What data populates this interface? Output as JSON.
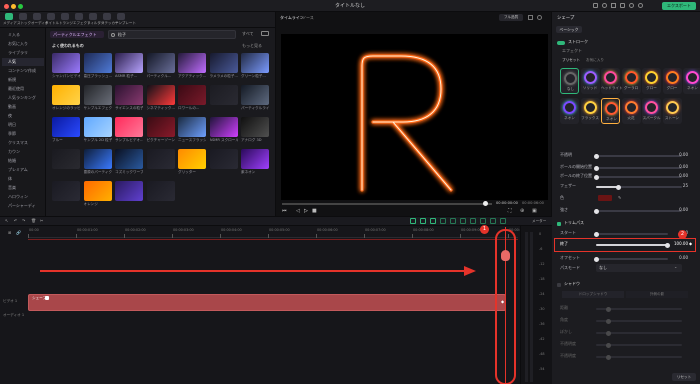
{
  "app": {
    "window_title": "タイトルなし"
  },
  "window_controls": [
    "#ff5f57",
    "#febc2e",
    "#28c840"
  ],
  "toolbar": {
    "items": [
      "メディア",
      "ストック",
      "オーディオ",
      "タイトル",
      "トランジ",
      "エフェクト",
      "フィルター",
      "ステッカー",
      "テンプレート"
    ]
  },
  "library": {
    "search_tab_label": "パーティクルエフェクト",
    "search_value": "粒子",
    "filter_label": "すべて",
    "sort_label": "もっと見る",
    "section_title": "よく使われるもの",
    "sort_label_2": "もっと見る",
    "items": [
      "シャンパンビデオ...",
      "高圧ブラッシュ...",
      "ASMR 粒子...",
      "パーティクル...",
      "アクアティック...",
      "ラメラメの粒子...",
      "グリーン粒子...",
      "オレンジのラッピング",
      "サンプルエフェクト...",
      "サイエンスの粒子...",
      "シネマティック...",
      "ロワールの...",
      "",
      "パーティクルライト",
      "ブルー",
      "サンプル 2D 粒子",
      "サンプルビデオ...",
      "ピクチャーゾーン",
      "ニュースフラッシュ",
      "ASMR スクロール",
      "アナログ 3D",
      "",
      "雪原のパーティクル",
      "コズミックワープ",
      "",
      "グリッター",
      "",
      "紫ネオン",
      "",
      "オレンジ",
      "",
      ""
    ]
  },
  "leftnav": {
    "items": [
      "ミ入る",
      "お気に入り",
      "ライブラリ",
      "人気",
      "コンテンツ作成",
      "新規",
      "最近使用",
      "人気ランキング",
      "動画",
      "夜",
      "明日",
      "季節",
      "クリスマス",
      "カウン",
      "結婚",
      "プレミアム",
      "体",
      "音楽",
      "ハロウィン",
      "パーシャーディ"
    ]
  },
  "preview": {
    "tab_player": "タイムライン",
    "tab_label": "ソース",
    "quality": "フル品質",
    "time_current": "00:00:00:00",
    "time_total": "00:00:06:00",
    "letter": "R"
  },
  "inspector": {
    "title": "シェープ",
    "tab_basic": "ベーシック",
    "stroke_section": "ストローク",
    "section_effect": "エフェクト",
    "preset_tab": "プリセット",
    "custom_tab": "お気に入り",
    "presets_row1": [
      "なし",
      "ソリッド",
      "ヘッドライト",
      "グーラロ",
      "グロー",
      "グロー",
      "ネオン"
    ],
    "presets_row2": [
      "ネオン",
      "フラックス",
      "ネオン",
      "火花",
      "スパークル",
      "ストーン"
    ],
    "sliders": [
      {
        "label": "不透明",
        "value": "0.00",
        "fraction": 0.0
      },
      {
        "label": "ボールの開始位置",
        "value": "0.00",
        "fraction": 0.0
      },
      {
        "label": "ボールの終了位置",
        "value": "0.00",
        "fraction": 0.0
      },
      {
        "label": "フェザー",
        "value": "25",
        "fraction": 0.25
      },
      {
        "label": "色",
        "value": "",
        "fraction": 0
      },
      {
        "label": "強さ",
        "value": "0.00",
        "fraction": 0.0
      }
    ],
    "trim_section": "トリムパス",
    "start_label": "スタート",
    "start_value": "0.00",
    "end_label": "終了",
    "end_value": "100.00",
    "offset_label": "オフセット",
    "offset_value": "0.00",
    "mode_label": "パスモード",
    "mode_value": "なし",
    "shadow_section": "シャドウ",
    "shadow_tab1": "ドロップシャドウ",
    "shadow_tab2": "外側の影",
    "shadow_rows": [
      "距離",
      "角度",
      "ぼかし",
      "不透明度",
      "不透明度"
    ],
    "reset_label": "リセット",
    "done_label": "エクスポート",
    "badge1": "1",
    "badge2": "2"
  },
  "timeline": {
    "ruler_ticks": [
      "00:00",
      "00:00:01:00",
      "00:00:02:00",
      "00:00:03:00",
      "00:00:04:00",
      "00:00:05:00",
      "00:00:06:00",
      "00:00:07:00",
      "00:00:08:00",
      "00:00:09:00",
      "00:00:10:00"
    ],
    "clip_label": "シェープ",
    "track_v": "ビデオ 1",
    "track_a": "オーディオ 1",
    "meter_labels": [
      "0",
      "-6",
      "-12",
      "-18",
      "-24",
      "-30",
      "-36",
      "-42",
      "-48",
      "-54"
    ],
    "badge1": "1",
    "meter_label": "メーター"
  },
  "colors": {
    "accent": "#2fb87a",
    "annotation": "#e5332a",
    "fire": "#ff7a2f"
  }
}
